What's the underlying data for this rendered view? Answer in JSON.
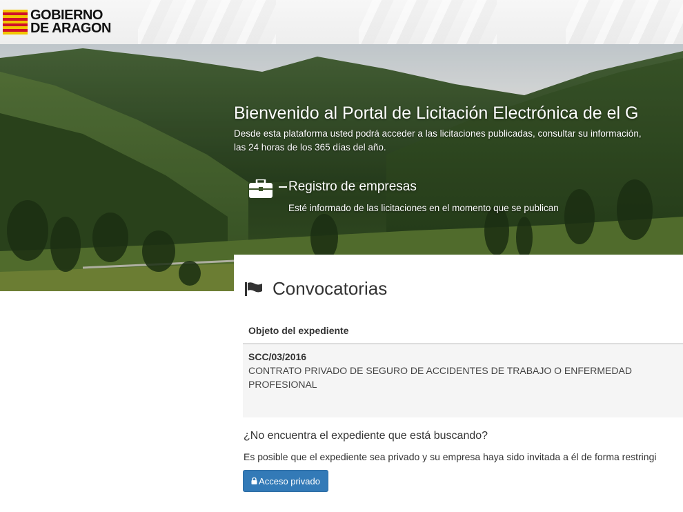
{
  "header": {
    "logo_line1": "GOBIERNO",
    "logo_line2": "DE ARAGON",
    "logo_colors": {
      "yellow": "#f2c500",
      "red": "#d0102a"
    }
  },
  "hero": {
    "title": "Bienvenido al Portal de Licitación Electrónica de el G",
    "desc_line1": "Desde esta plataforma usted podrá acceder a las licitaciones publicadas, consultar su información,",
    "desc_line2": "las 24 horas de los 365 días del año.",
    "registro": {
      "icon": "briefcase-icon",
      "title": "Registro de empresas",
      "desc": "Esté informado de las licitaciones en el momento que se publican"
    }
  },
  "convocatorias": {
    "icon": "flag-icon",
    "title": "Convocatorias",
    "table": {
      "header": "Objeto del expediente",
      "rows": [
        {
          "code": "SCC/03/2016",
          "description": "CONTRATO PRIVADO DE SEGURO DE ACCIDENTES DE TRABAJO O ENFERMEDAD PROFESIONAL"
        }
      ]
    },
    "not_found_title": "¿No encuentra el expediente que está buscando?",
    "not_found_desc": "Es posible que el expediente sea privado y su empresa haya sido invitada a él de forma restringi",
    "private_button": {
      "icon": "lock-icon",
      "label": "Acceso privado",
      "color": "#337ab7"
    }
  }
}
